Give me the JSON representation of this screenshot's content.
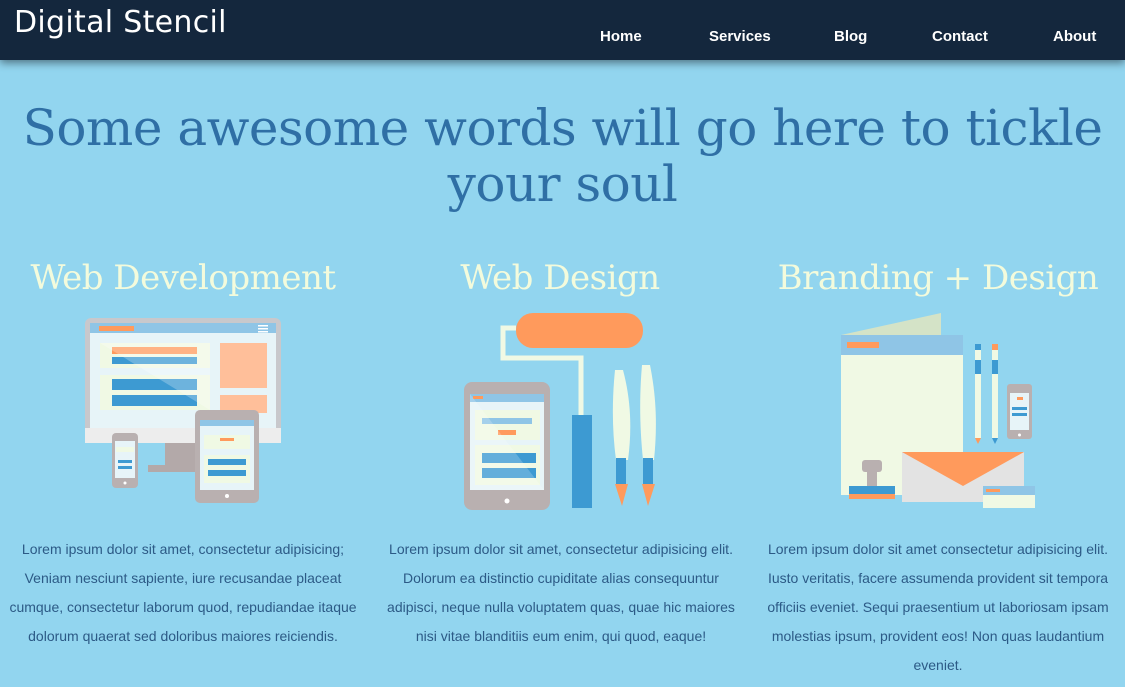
{
  "nav": {
    "brand": "Digital Stencil",
    "links": [
      "Home",
      "Services",
      "Blog",
      "Contact",
      "About"
    ]
  },
  "hero": {
    "line1": "Some awesome words will go here to tickle",
    "line2": "your soul"
  },
  "columns": [
    {
      "title": "Web Development",
      "icon": "devices-icon",
      "text": "Lorem ipsum dolor sit amet, consectetur adipisicing; Veniam nesciunt sapiente, iure recusandae placeat cumque, consectetur laborum quod, repudiandae itaque dolorum quaerat sed doloribus maiores reiciendis."
    },
    {
      "title": "Web Design",
      "icon": "paint-roller-icon",
      "text": "Lorem ipsum dolor sit amet, consectetur adipisicing elit. Dolorum ea distinctio cupiditate alias consequuntur adipisci, neque nulla voluptatem quas, quae hic maiores nisi vitae blanditiis eum enim, qui quod, eaque!"
    },
    {
      "title": "Branding + Design",
      "icon": "stationery-icon",
      "text": "Lorem ipsum dolor sit amet consectetur adipisicing elit. Iusto veritatis, facere assumenda provident sit tempora officiis eveniet. Sequi praesentium ut laboriosam ipsam molestias ipsum, provident eos! Non quas laudantium eveniet."
    }
  ],
  "colors": {
    "background": "#92d5ef",
    "navbar": "#14273d",
    "heading": "#2f6fa5",
    "column_title": "#f3fbdc",
    "body_text": "#2c5a86",
    "accent_orange": "#ff9a5c",
    "accent_blue": "#3d9ad2"
  }
}
